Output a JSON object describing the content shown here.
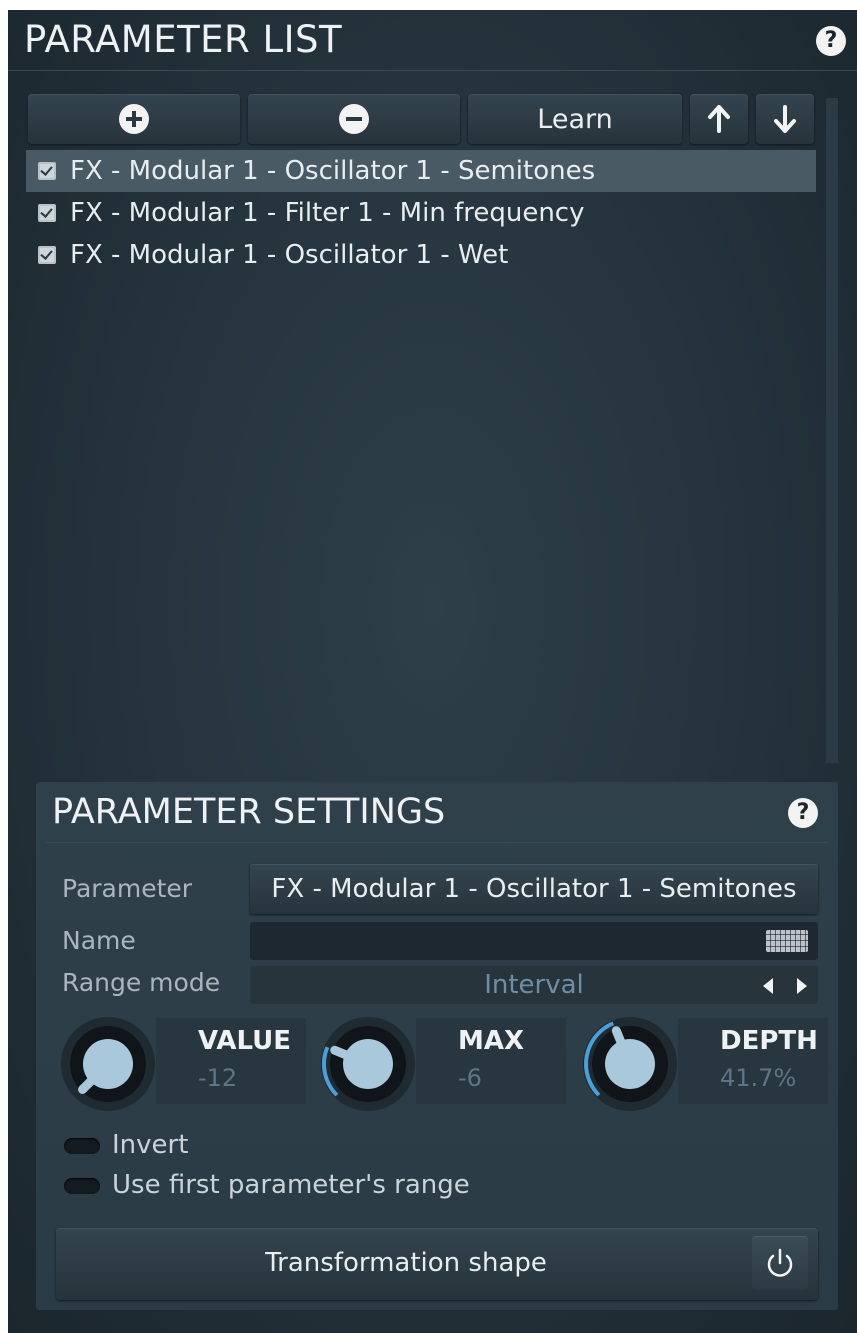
{
  "parameter_list": {
    "title": "PARAMETER LIST",
    "help_label": "?",
    "toolbar": {
      "add_icon": "plus-circle-icon",
      "remove_icon": "minus-circle-icon",
      "learn_label": "Learn",
      "move_up_icon": "arrow-up-icon",
      "move_down_icon": "arrow-down-icon"
    },
    "items": [
      {
        "label": "FX - Modular 1 - Oscillator 1 - Semitones",
        "checked": true,
        "selected": true
      },
      {
        "label": "FX - Modular 1 - Filter 1 - Min frequency",
        "checked": true,
        "selected": false
      },
      {
        "label": "FX - Modular 1 - Oscillator 1 - Wet",
        "checked": true,
        "selected": false
      }
    ]
  },
  "parameter_settings": {
    "title": "PARAMETER SETTINGS",
    "help_label": "?",
    "parameter_label": "Parameter",
    "parameter_value": "FX - Modular 1 - Oscillator 1 - Semitones",
    "name_label": "Name",
    "name_value": "",
    "range_mode_label": "Range mode",
    "range_mode_value": "Interval",
    "knobs": [
      {
        "name": "VALUE",
        "value": "-12",
        "level": 0.0
      },
      {
        "name": "MAX",
        "value": "-6",
        "level": 0.25
      },
      {
        "name": "DEPTH",
        "value": "41.7%",
        "level": 0.417
      }
    ],
    "invert_label": "Invert",
    "invert_on": false,
    "first_range_label": "Use first parameter's range",
    "first_range_on": false,
    "shape_label": "Transformation shape",
    "accent_color": "#4a9fd8",
    "knob_face_color": "#a9c8dc"
  }
}
